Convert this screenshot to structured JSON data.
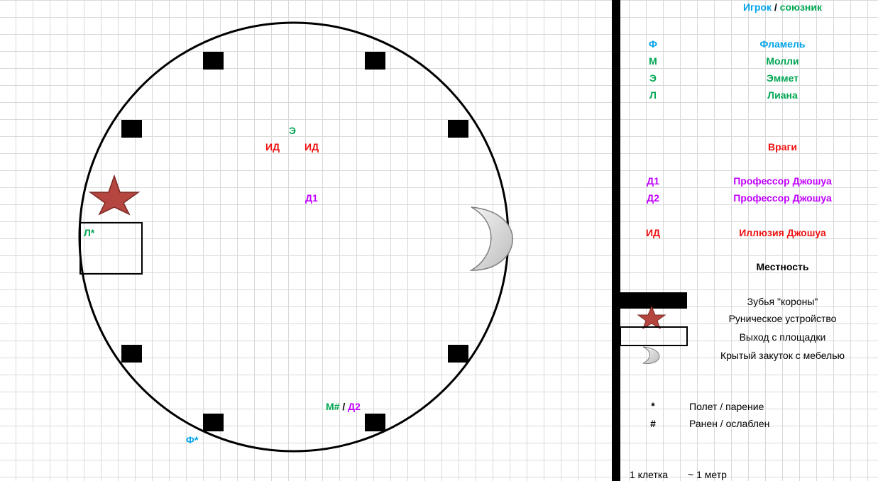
{
  "map": {
    "tokens": {
      "emmet": "Э",
      "illusion_left": "ИД",
      "illusion_right": "ИД",
      "d1": "Д1",
      "liana": "Л*",
      "molly": "М#",
      "slash": "/",
      "d2": "Д2",
      "flamel": "Ф*"
    }
  },
  "legend": {
    "header": {
      "player": "Игрок",
      "slash": "/",
      "ally": "союзник"
    },
    "allies": [
      {
        "symbol": "Ф",
        "name": "Фламель"
      },
      {
        "symbol": "М",
        "name": "Молли"
      },
      {
        "symbol": "Э",
        "name": "Эммет"
      },
      {
        "symbol": "Л",
        "name": "Лиана"
      }
    ],
    "enemies_title": "Враги",
    "enemies": [
      {
        "symbol": "Д1",
        "name": "Профессор Джошуа"
      },
      {
        "symbol": "Д2",
        "name": "Профессор Джошуа"
      },
      {
        "symbol": "ИД",
        "name": "Иллюзия Джошуа"
      }
    ],
    "terrain_title": "Местность",
    "terrain": [
      {
        "icon": "black-block-icon",
        "label": "Зубья \"короны\""
      },
      {
        "icon": "star-icon",
        "label": "Руническое устройство"
      },
      {
        "icon": "rectangle-outline-icon",
        "label": "Выход с площадки"
      },
      {
        "icon": "crescent-icon",
        "label": "Крытый закуток с мебелью"
      }
    ],
    "conditions": [
      {
        "symbol": "*",
        "label": "Полет / парение"
      },
      {
        "symbol": "#",
        "label": "Ранен / ослаблен"
      }
    ],
    "scale": {
      "unit": "1 клетка",
      "value": "~ 1 метр"
    }
  },
  "colors": {
    "player": "#00a2e8",
    "ally": "#00a651",
    "enemy": "#ee1111",
    "boss": "#c000ff",
    "star": "#b5463f"
  }
}
